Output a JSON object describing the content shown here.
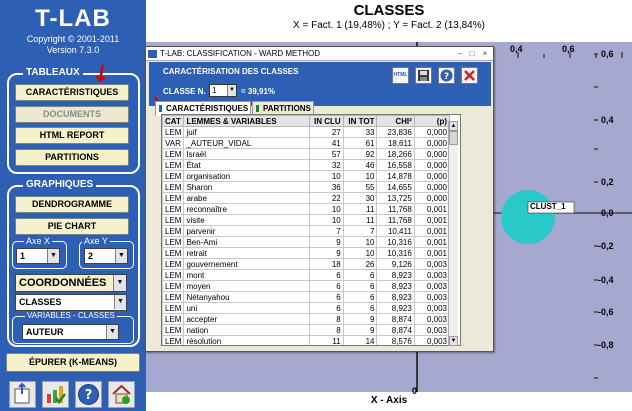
{
  "app": {
    "logo": "T-LAB",
    "copyright": "Copyright © 2001-2011",
    "version": "Version 7.3.0"
  },
  "sidebar": {
    "tableaux_title": "TABLEAUX",
    "buttons": {
      "caracteristiques": "CARACTÉRISTIQUES",
      "documents": "DOCUMENTS",
      "html_report": "HTML REPORT",
      "partitions": "PARTITIONS"
    },
    "graphiques_title": "GRAPHIQUES",
    "graph_buttons": {
      "dendrogramme": "DENDROGRAMME",
      "pie_chart": "PIE CHART"
    },
    "axe_x_label": "Axe X",
    "axe_x_value": "1",
    "axe_y_label": "Axe Y",
    "axe_y_value": "2",
    "coordonnees": "COORDONNÉES",
    "classes_select": "CLASSES",
    "variables_title": "VARIABLES - CLASSES",
    "variables_select": "AUTEUR",
    "epurer": "ÉPURER (K-MEANS)",
    "tool_icons": [
      "export-icon",
      "chart-check-icon",
      "help-icon",
      "home-icon"
    ]
  },
  "chart": {
    "title": "CLASSES",
    "subtitle": "X = Fact. 1 (19,48%) ; Y = Fact. 2 (13,84%)",
    "x_axis_title": "X - Axis",
    "x_ticks_visible": [
      "0,4",
      "0,6"
    ],
    "x_zero": "0",
    "y_ticks": [
      "0,6",
      "0,4",
      "0,2",
      "0,0",
      "-0,2",
      "-0,4",
      "-0,6",
      "-0,8"
    ],
    "cluster_label": "CLUST_1",
    "colors": {
      "plot_bg": "#a7a8d0",
      "cluster": "#29c9c9"
    }
  },
  "dialog": {
    "title": "T-LAB: CLASSIFICATION - WARD METHOD",
    "header": "CARACTÉRISATION DES CLASSES",
    "classe_label": "CLASSE N.",
    "classe_value": "1",
    "percent": "= 39,91%",
    "icons": [
      "html-icon",
      "save-icon",
      "help-icon",
      "close-icon"
    ],
    "tabs": [
      "CARACTÉRISTIQUES",
      "PARTITIONS"
    ],
    "table": {
      "headers": [
        "CAT",
        "LEMMES & VARIABLES",
        "IN CLU",
        "IN TOT",
        "CHI²",
        "(p)"
      ],
      "rows": [
        [
          "LEM",
          "juif",
          "27",
          "33",
          "23,836",
          "0,000"
        ],
        [
          "VAR",
          "_AUTEUR_VIDAL",
          "41",
          "61",
          "18,611",
          "0,000"
        ],
        [
          "LEM",
          "Israël",
          "57",
          "92",
          "18,266",
          "0,000"
        ],
        [
          "LEM",
          "État",
          "32",
          "46",
          "16,558",
          "0,000"
        ],
        [
          "LEM",
          "organisation",
          "10",
          "10",
          "14,878",
          "0,000"
        ],
        [
          "LEM",
          "Sharon",
          "36",
          "55",
          "14,655",
          "0,000"
        ],
        [
          "LEM",
          "arabe",
          "22",
          "30",
          "13,725",
          "0,000"
        ],
        [
          "LEM",
          "reconnaître",
          "10",
          "11",
          "11,768",
          "0,001"
        ],
        [
          "LEM",
          "visite",
          "10",
          "11",
          "11,768",
          "0,001"
        ],
        [
          "LEM",
          "parvenir",
          "7",
          "7",
          "10,411",
          "0,001"
        ],
        [
          "LEM",
          "Ben-Ami",
          "9",
          "10",
          "10,316",
          "0,001"
        ],
        [
          "LEM",
          "retrait",
          "9",
          "10",
          "10,316",
          "0,001"
        ],
        [
          "LEM",
          "gouvernement",
          "18",
          "26",
          "9,126",
          "0,003"
        ],
        [
          "LEM",
          "mont",
          "6",
          "6",
          "8,923",
          "0,003"
        ],
        [
          "LEM",
          "moyen",
          "6",
          "6",
          "8,923",
          "0,003"
        ],
        [
          "LEM",
          "Nétanyahou",
          "6",
          "6",
          "8,923",
          "0,003"
        ],
        [
          "LEM",
          "uni",
          "6",
          "6",
          "8,923",
          "0,003"
        ],
        [
          "LEM",
          "accepter",
          "8",
          "9",
          "8,874",
          "0,003"
        ],
        [
          "LEM",
          "nation",
          "8",
          "9",
          "8,874",
          "0,003"
        ],
        [
          "LEM",
          "résolution",
          "11",
          "14",
          "8,576",
          "0,003"
        ]
      ]
    }
  }
}
